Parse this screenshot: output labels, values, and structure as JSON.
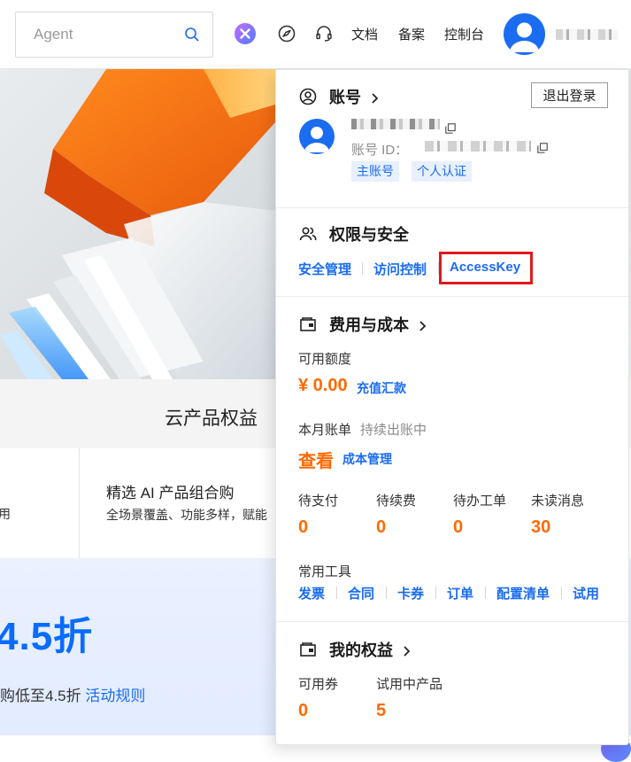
{
  "topbar": {
    "search_placeholder": "Agent",
    "nav_links": [
      "文档",
      "备案",
      "控制台"
    ]
  },
  "hero": {
    "strip_title": "云产品权益",
    "feature_title": "精选 AI 产品组合购",
    "feature_desc": "全场景覆盖、功能多样，赋能",
    "feature_left_cut": "用",
    "promo_big": "4.5折",
    "promo_sub": "购低至4.5折",
    "promo_link": "活动规则"
  },
  "account": {
    "title": "账号",
    "logout": "退出登录",
    "id_label": "账号 ID：",
    "tags": [
      "主账号",
      "个人认证"
    ]
  },
  "security": {
    "title": "权限与安全",
    "links": [
      "安全管理",
      "访问控制",
      "AccessKey"
    ]
  },
  "billing": {
    "title": "费用与成本",
    "balance_label": "可用额度",
    "balance_value": "¥ 0.00",
    "recharge": "充值汇款",
    "month_bill_label": "本月账单",
    "month_bill_status": "持续出账中",
    "view": "查看",
    "cost_manage": "成本管理",
    "stats": [
      {
        "label": "待支付",
        "value": "0"
      },
      {
        "label": "待续费",
        "value": "0"
      },
      {
        "label": "待办工单",
        "value": "0"
      },
      {
        "label": "未读消息",
        "value": "30"
      }
    ],
    "tools_label": "常用工具",
    "tools": [
      "发票",
      "合同",
      "卡券",
      "订单",
      "配置清单",
      "试用"
    ]
  },
  "benefits": {
    "title": "我的权益",
    "items": [
      {
        "label": "可用券",
        "value": "0"
      },
      {
        "label": "试用中产品",
        "value": "5"
      }
    ]
  },
  "colors": {
    "accent": "#1a6cf0",
    "orange": "#ff6a00",
    "highlight": "#e0191f"
  }
}
